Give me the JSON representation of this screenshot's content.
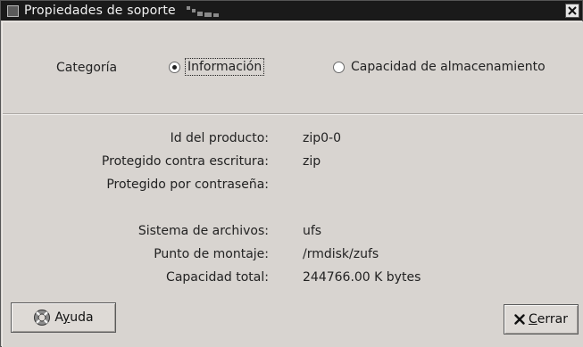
{
  "window": {
    "title": "Propiedades de soporte"
  },
  "category": {
    "label": "Categoría",
    "options": [
      {
        "label": "Información",
        "selected": true
      },
      {
        "label": "Capacidad de almacenamiento",
        "selected": false
      }
    ]
  },
  "properties": [
    {
      "label": "Id del producto:",
      "value": "zip0-0"
    },
    {
      "label": "Protegido contra escritura:",
      "value": "zip"
    },
    {
      "label": "Protegido por contraseña:",
      "value": ""
    },
    {
      "label": "Sistema de archivos:",
      "value": "ufs"
    },
    {
      "label": "Punto de montaje:",
      "value": "/rmdisk/zufs"
    },
    {
      "label": "Capacidad total:",
      "value": "244766.00 K bytes"
    }
  ],
  "buttons": {
    "help": {
      "pre": "A",
      "mnemonic": "y",
      "post": "uda",
      "icon": "lifebuoy-icon"
    },
    "close": {
      "pre": "",
      "mnemonic": "C",
      "post": "errar",
      "icon": "close-x-icon"
    }
  },
  "colors": {
    "titlebar": "#1a1a1a",
    "window_bg": "#d8d4d0"
  }
}
